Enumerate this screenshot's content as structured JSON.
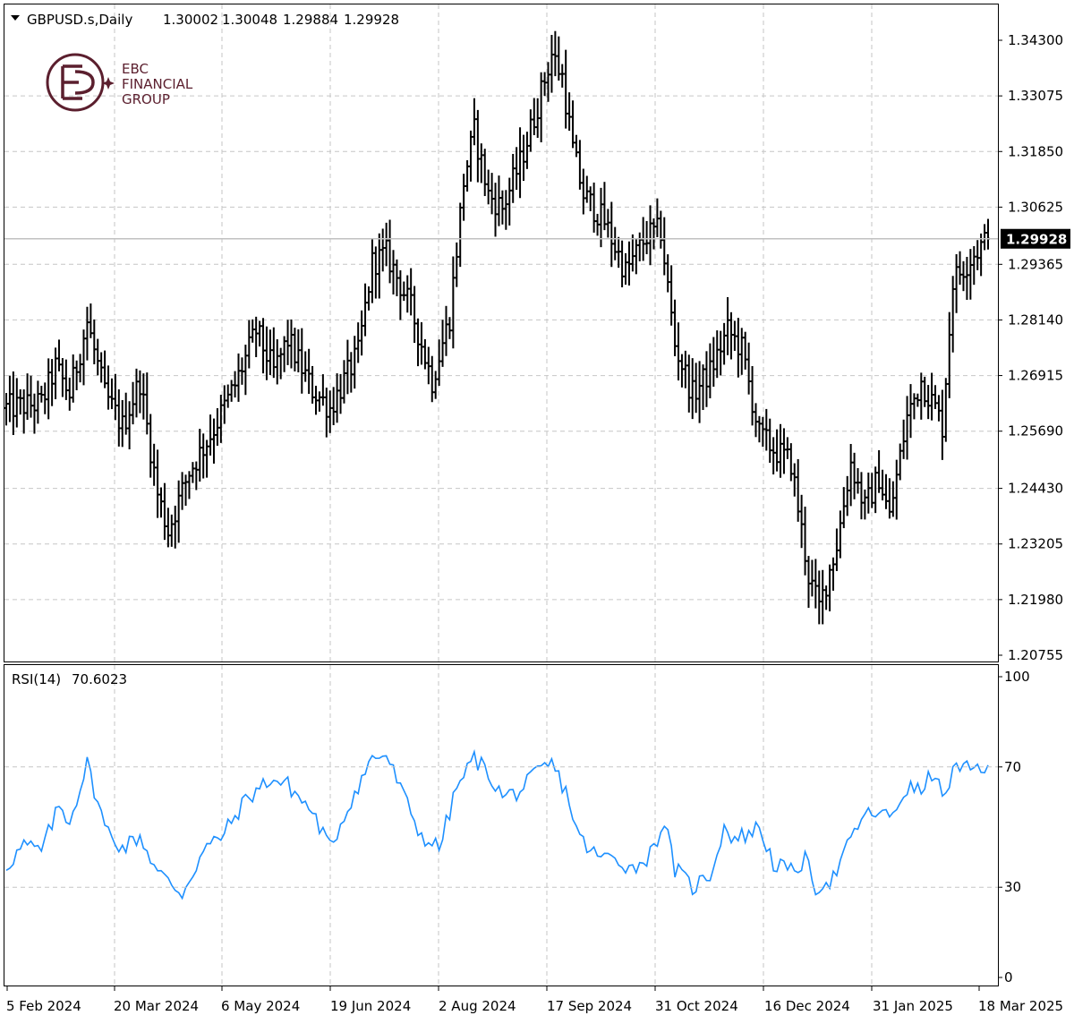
{
  "header": {
    "symbol_label": "GBPUSD.s,Daily",
    "open": "1.30002",
    "high": "1.30048",
    "low": "1.29884",
    "close": "1.29928"
  },
  "logo": {
    "line1": "EBC",
    "line2": "FINANCIAL",
    "line3": "GROUP"
  },
  "indicator": {
    "label": "RSI(14)",
    "value": "70.6023"
  },
  "current_price_label": "1.29928",
  "colors": {
    "bars": "#000000",
    "rsi": "#1e90ff",
    "grid": "#c6c6c6",
    "brand": "#5b1f2e"
  },
  "chart_data": [
    {
      "type": "ohlc",
      "title": "GBPUSD.s,Daily",
      "series": [
        {
          "name": "GBPUSD.s",
          "points": []
        }
      ],
      "ylim": [
        1.20755,
        1.343
      ],
      "y_ticks": [
        "1.34300",
        "1.33075",
        "1.31850",
        "1.30625",
        "1.29365",
        "1.28140",
        "1.26915",
        "1.25690",
        "1.24430",
        "1.23205",
        "1.21980",
        "1.20755"
      ],
      "x_ticks": [
        "5 Feb 2024",
        "20 Mar 2024",
        "6 May 2024",
        "19 Jun 2024",
        "2 Aug 2024",
        "17 Sep 2024",
        "31 Oct 2024",
        "16 Dec 2024",
        "31 Jan 2025",
        "18 Mar 2025"
      ],
      "last_price": 1.29928,
      "grid": true,
      "close_trajectory": [
        [
          0,
          1.262
        ],
        [
          10,
          1.263
        ],
        [
          14,
          1.271
        ],
        [
          18,
          1.265
        ],
        [
          23,
          1.281
        ],
        [
          28,
          1.265
        ],
        [
          33,
          1.258
        ],
        [
          38,
          1.268
        ],
        [
          43,
          1.243
        ],
        [
          46,
          1.235
        ],
        [
          52,
          1.248
        ],
        [
          58,
          1.256
        ],
        [
          65,
          1.267
        ],
        [
          71,
          1.279
        ],
        [
          76,
          1.27
        ],
        [
          80,
          1.277
        ],
        [
          87,
          1.266
        ],
        [
          92,
          1.262
        ],
        [
          100,
          1.274
        ],
        [
          104,
          1.294
        ],
        [
          108,
          1.296
        ],
        [
          115,
          1.284
        ],
        [
          121,
          1.268
        ],
        [
          126,
          1.282
        ],
        [
          130,
          1.312
        ],
        [
          133,
          1.323
        ],
        [
          137,
          1.309
        ],
        [
          141,
          1.306
        ],
        [
          146,
          1.316
        ],
        [
          150,
          1.326
        ],
        [
          155,
          1.34
        ],
        [
          158,
          1.335
        ],
        [
          161,
          1.319
        ],
        [
          164,
          1.309
        ],
        [
          170,
          1.303
        ],
        [
          176,
          1.292
        ],
        [
          182,
          1.3
        ],
        [
          186,
          1.301
        ],
        [
          190,
          1.276
        ],
        [
          195,
          1.265
        ],
        [
          200,
          1.27
        ],
        [
          205,
          1.279
        ],
        [
          209,
          1.275
        ],
        [
          214,
          1.256
        ],
        [
          218,
          1.253
        ],
        [
          223,
          1.25
        ],
        [
          228,
          1.225
        ],
        [
          231,
          1.218
        ],
        [
          236,
          1.232
        ],
        [
          240,
          1.25
        ],
        [
          244,
          1.24
        ],
        [
          248,
          1.247
        ],
        [
          251,
          1.238
        ],
        [
          256,
          1.26
        ],
        [
          260,
          1.268
        ],
        [
          264,
          1.262
        ],
        [
          266,
          1.258
        ],
        [
          269,
          1.29
        ],
        [
          275,
          1.296
        ],
        [
          279,
          1.29928
        ]
      ]
    },
    {
      "type": "line",
      "title": "RSI(14) 70.6023",
      "series": [
        {
          "name": "RSI(14)",
          "values": []
        }
      ],
      "ylim": [
        0,
        100
      ],
      "y_ticks": [
        "100",
        "70",
        "30",
        "0"
      ],
      "levels": [
        70,
        30
      ],
      "last_value": 70.6023,
      "trajectory": [
        [
          0,
          37
        ],
        [
          5,
          44
        ],
        [
          10,
          42
        ],
        [
          15,
          57
        ],
        [
          18,
          52
        ],
        [
          23,
          71
        ],
        [
          28,
          50
        ],
        [
          33,
          43
        ],
        [
          38,
          47
        ],
        [
          43,
          35
        ],
        [
          46,
          32
        ],
        [
          50,
          28
        ],
        [
          56,
          42
        ],
        [
          62,
          48
        ],
        [
          68,
          59
        ],
        [
          75,
          66
        ],
        [
          80,
          64
        ],
        [
          87,
          55
        ],
        [
          92,
          43
        ],
        [
          98,
          59
        ],
        [
          104,
          73
        ],
        [
          108,
          74
        ],
        [
          113,
          60
        ],
        [
          118,
          47
        ],
        [
          123,
          43
        ],
        [
          128,
          63
        ],
        [
          133,
          73
        ],
        [
          137,
          68
        ],
        [
          141,
          60
        ],
        [
          146,
          62
        ],
        [
          151,
          68
        ],
        [
          155,
          71
        ],
        [
          159,
          62
        ],
        [
          163,
          46
        ],
        [
          168,
          40
        ],
        [
          173,
          40
        ],
        [
          178,
          36
        ],
        [
          183,
          41
        ],
        [
          187,
          52
        ],
        [
          190,
          36
        ],
        [
          195,
          30
        ],
        [
          200,
          34
        ],
        [
          204,
          50
        ],
        [
          207,
          46
        ],
        [
          211,
          48
        ],
        [
          214,
          50
        ],
        [
          218,
          38
        ],
        [
          223,
          35
        ],
        [
          227,
          39
        ],
        [
          230,
          30
        ],
        [
          235,
          33
        ],
        [
          239,
          43
        ],
        [
          243,
          53
        ],
        [
          247,
          55
        ],
        [
          251,
          53
        ],
        [
          256,
          63
        ],
        [
          260,
          62
        ],
        [
          264,
          69
        ],
        [
          266,
          58
        ],
        [
          269,
          69
        ],
        [
          274,
          69
        ],
        [
          279,
          70.6
        ]
      ]
    }
  ]
}
